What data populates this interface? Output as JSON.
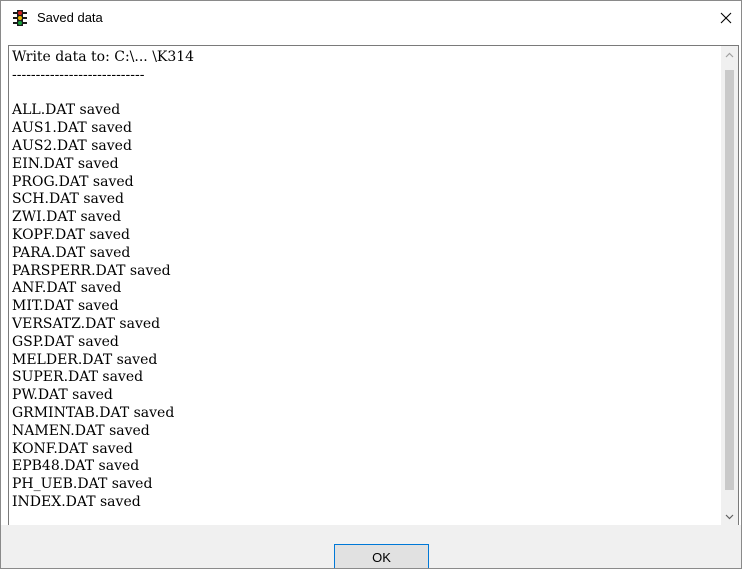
{
  "window": {
    "title": "Saved data",
    "icon": "traffic-light-icon"
  },
  "content": {
    "lines": [
      "Write data to: C:\\... \\K314",
      "----------------------------",
      "",
      "ALL.DAT saved",
      "AUS1.DAT saved",
      "AUS2.DAT saved",
      "EIN.DAT saved",
      "PROG.DAT saved",
      "SCH.DAT saved",
      "ZWI.DAT saved",
      "KOPF.DAT saved",
      "PARA.DAT saved",
      "PARSPERR.DAT saved",
      "ANF.DAT saved",
      "MIT.DAT saved",
      "VERSATZ.DAT saved",
      "GSP.DAT saved",
      "MELDER.DAT saved",
      "SUPER.DAT saved",
      "PW.DAT saved",
      "GRMINTAB.DAT saved",
      "NAMEN.DAT saved",
      "KONF.DAT saved",
      "EPB48.DAT saved",
      "PH_UEB.DAT saved",
      "INDEX.DAT saved"
    ]
  },
  "buttons": {
    "ok_label": "OK"
  },
  "colors": {
    "button_border_accent": "#0078d7",
    "button_bg": "#e1e1e1",
    "footer_bg": "#f0f0f0"
  }
}
